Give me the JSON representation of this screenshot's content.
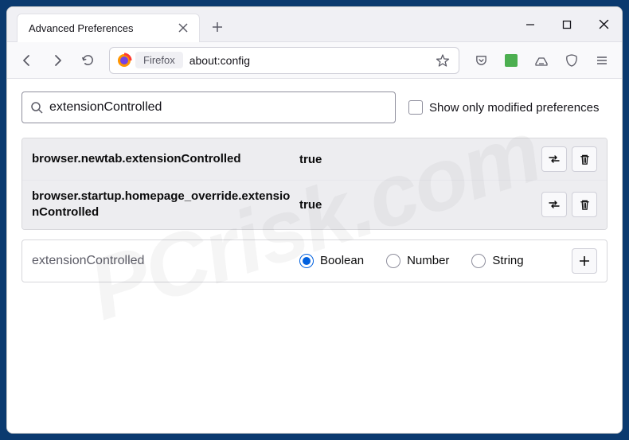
{
  "window": {
    "tab_title": "Advanced Preferences",
    "identity_label": "Firefox",
    "url": "about:config"
  },
  "search": {
    "value": "extensionControlled",
    "checkbox_label": "Show only modified preferences"
  },
  "prefs": [
    {
      "name": "browser.newtab.extensionControlled",
      "value": "true"
    },
    {
      "name": "browser.startup.homepage_override.extensionControlled",
      "value": "true"
    }
  ],
  "new_pref": {
    "name": "extensionControlled",
    "types": {
      "boolean": "Boolean",
      "number": "Number",
      "string": "String"
    },
    "selected": "boolean"
  },
  "watermark": {
    "line1": "PCrisk.com"
  }
}
